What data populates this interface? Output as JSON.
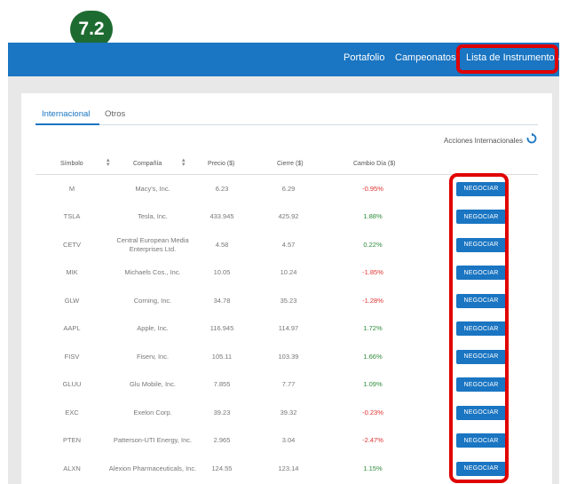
{
  "step_badge": "7.2",
  "nav": {
    "portfolio": "Portafolio",
    "championships": "Campeonatos",
    "instruments": "Lista de Instrumentos"
  },
  "tabs": {
    "international": "Internacional",
    "others": "Otros"
  },
  "refresh_label": "Acciones Internacionales",
  "columns": {
    "symbol": "Símbolo",
    "company": "Compañía",
    "price": "Precio ($)",
    "close": "Cierre ($)",
    "change": "Cambio Día ($)"
  },
  "trade_label": "NEGOCIAR",
  "rows": [
    {
      "symbol": "M",
      "company": "Macy's, Inc.",
      "price": "6.23",
      "close": "6.29",
      "change": "-0.95%",
      "direction": "neg"
    },
    {
      "symbol": "TSLA",
      "company": "Tesla, Inc.",
      "price": "433.945",
      "close": "425.92",
      "change": "1.88%",
      "direction": "pos"
    },
    {
      "symbol": "CETV",
      "company": "Central European Media Enterprises Ltd.",
      "price": "4.58",
      "close": "4.57",
      "change": "0.22%",
      "direction": "pos"
    },
    {
      "symbol": "MIK",
      "company": "Michaels Cos., Inc.",
      "price": "10.05",
      "close": "10.24",
      "change": "-1.85%",
      "direction": "neg"
    },
    {
      "symbol": "GLW",
      "company": "Corning, Inc.",
      "price": "34.78",
      "close": "35.23",
      "change": "-1.28%",
      "direction": "neg"
    },
    {
      "symbol": "AAPL",
      "company": "Apple, Inc.",
      "price": "116.945",
      "close": "114.97",
      "change": "1.72%",
      "direction": "pos"
    },
    {
      "symbol": "FISV",
      "company": "Fiserv, Inc.",
      "price": "105.11",
      "close": "103.39",
      "change": "1.66%",
      "direction": "pos"
    },
    {
      "symbol": "GLUU",
      "company": "Glu Mobile, Inc.",
      "price": "7.855",
      "close": "7.77",
      "change": "1.09%",
      "direction": "pos"
    },
    {
      "symbol": "EXC",
      "company": "Exelon Corp.",
      "price": "39.23",
      "close": "39.32",
      "change": "-0.23%",
      "direction": "neg"
    },
    {
      "symbol": "PTEN",
      "company": "Patterson-UTI Energy, Inc.",
      "price": "2.965",
      "close": "3.04",
      "change": "-2.47%",
      "direction": "neg"
    },
    {
      "symbol": "ALXN",
      "company": "Alexion Pharmaceuticals, Inc.",
      "price": "124.55",
      "close": "123.14",
      "change": "1.15%",
      "direction": "pos"
    }
  ],
  "colors": {
    "brand": "#1a75c2",
    "highlight": "#e00000",
    "badge": "#1e6b32",
    "positive": "#2e8b3a",
    "negative": "#e03030"
  }
}
